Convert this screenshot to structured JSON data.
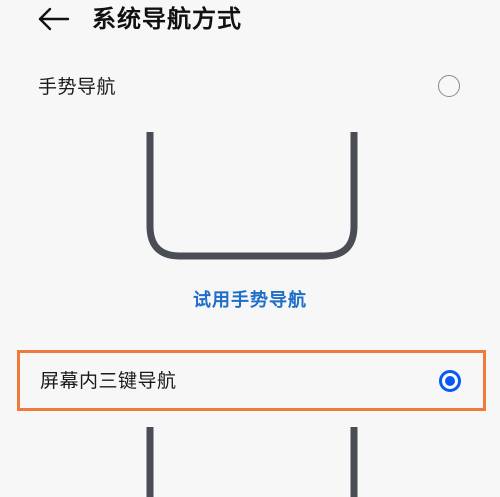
{
  "header": {
    "title": "系统导航方式"
  },
  "gesture_option": {
    "label": "手势导航",
    "selected": false
  },
  "try_gesture_link": "试用手势导航",
  "three_key_option": {
    "label": "屏幕内三键导航",
    "selected": true
  },
  "colors": {
    "accent": "#0a59f7",
    "link": "#1f6fc9",
    "highlight_border": "#ee7b3c",
    "illustration": "#4a4d55"
  }
}
